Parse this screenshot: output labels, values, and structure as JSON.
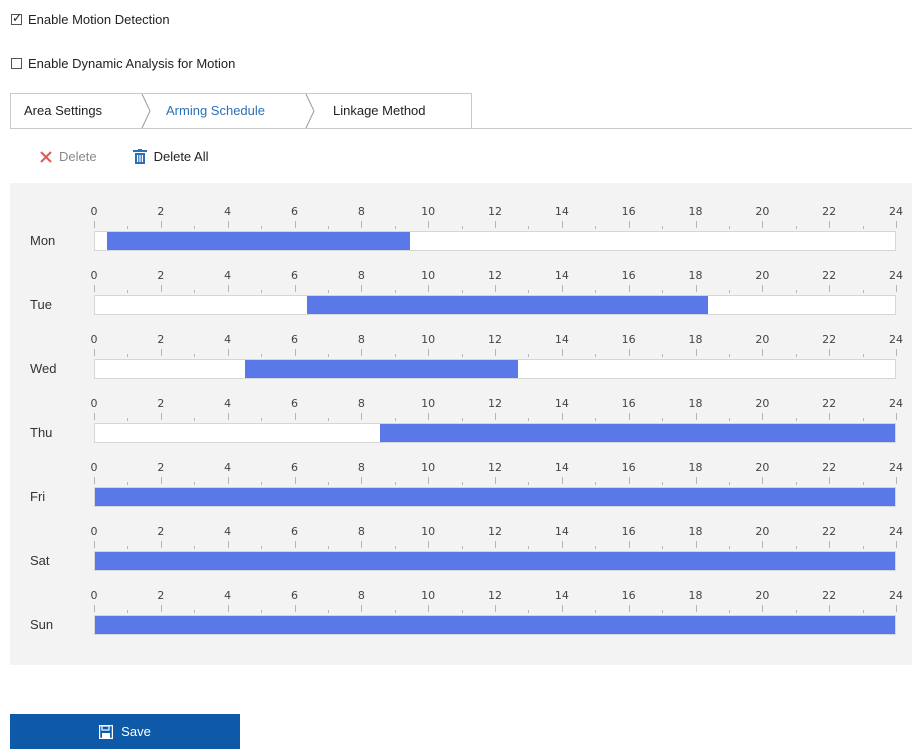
{
  "checkboxes": {
    "motion": {
      "label": "Enable Motion Detection",
      "checked": true
    },
    "dynamic": {
      "label": "Enable Dynamic Analysis for Motion",
      "checked": false
    }
  },
  "tabs": [
    {
      "label": "Area Settings",
      "active": false
    },
    {
      "label": "Arming Schedule",
      "active": true
    },
    {
      "label": "Linkage Method",
      "active": false
    }
  ],
  "toolbar": {
    "delete_label": "Delete",
    "delete_all_label": "Delete All"
  },
  "schedule": {
    "hour_ticks": [
      "0",
      "2",
      "4",
      "6",
      "8",
      "10",
      "12",
      "14",
      "16",
      "18",
      "20",
      "22",
      "24"
    ],
    "days": [
      {
        "label": "Mon",
        "ranges": [
          [
            0.35,
            9.45
          ]
        ]
      },
      {
        "label": "Tue",
        "ranges": [
          [
            6.35,
            18.4
          ]
        ]
      },
      {
        "label": "Wed",
        "ranges": [
          [
            4.5,
            12.7
          ]
        ]
      },
      {
        "label": "Thu",
        "ranges": [
          [
            8.55,
            24
          ]
        ]
      },
      {
        "label": "Fri",
        "ranges": [
          [
            0,
            24
          ]
        ]
      },
      {
        "label": "Sat",
        "ranges": [
          [
            0,
            24
          ]
        ]
      },
      {
        "label": "Sun",
        "ranges": [
          [
            0,
            24
          ]
        ]
      }
    ]
  },
  "colors": {
    "accent": "#2d6fb7",
    "bar": "#5b78e8",
    "save_bg": "#0f5aa8",
    "delete_x": "#e05a5a"
  },
  "save": {
    "label": "Save"
  }
}
